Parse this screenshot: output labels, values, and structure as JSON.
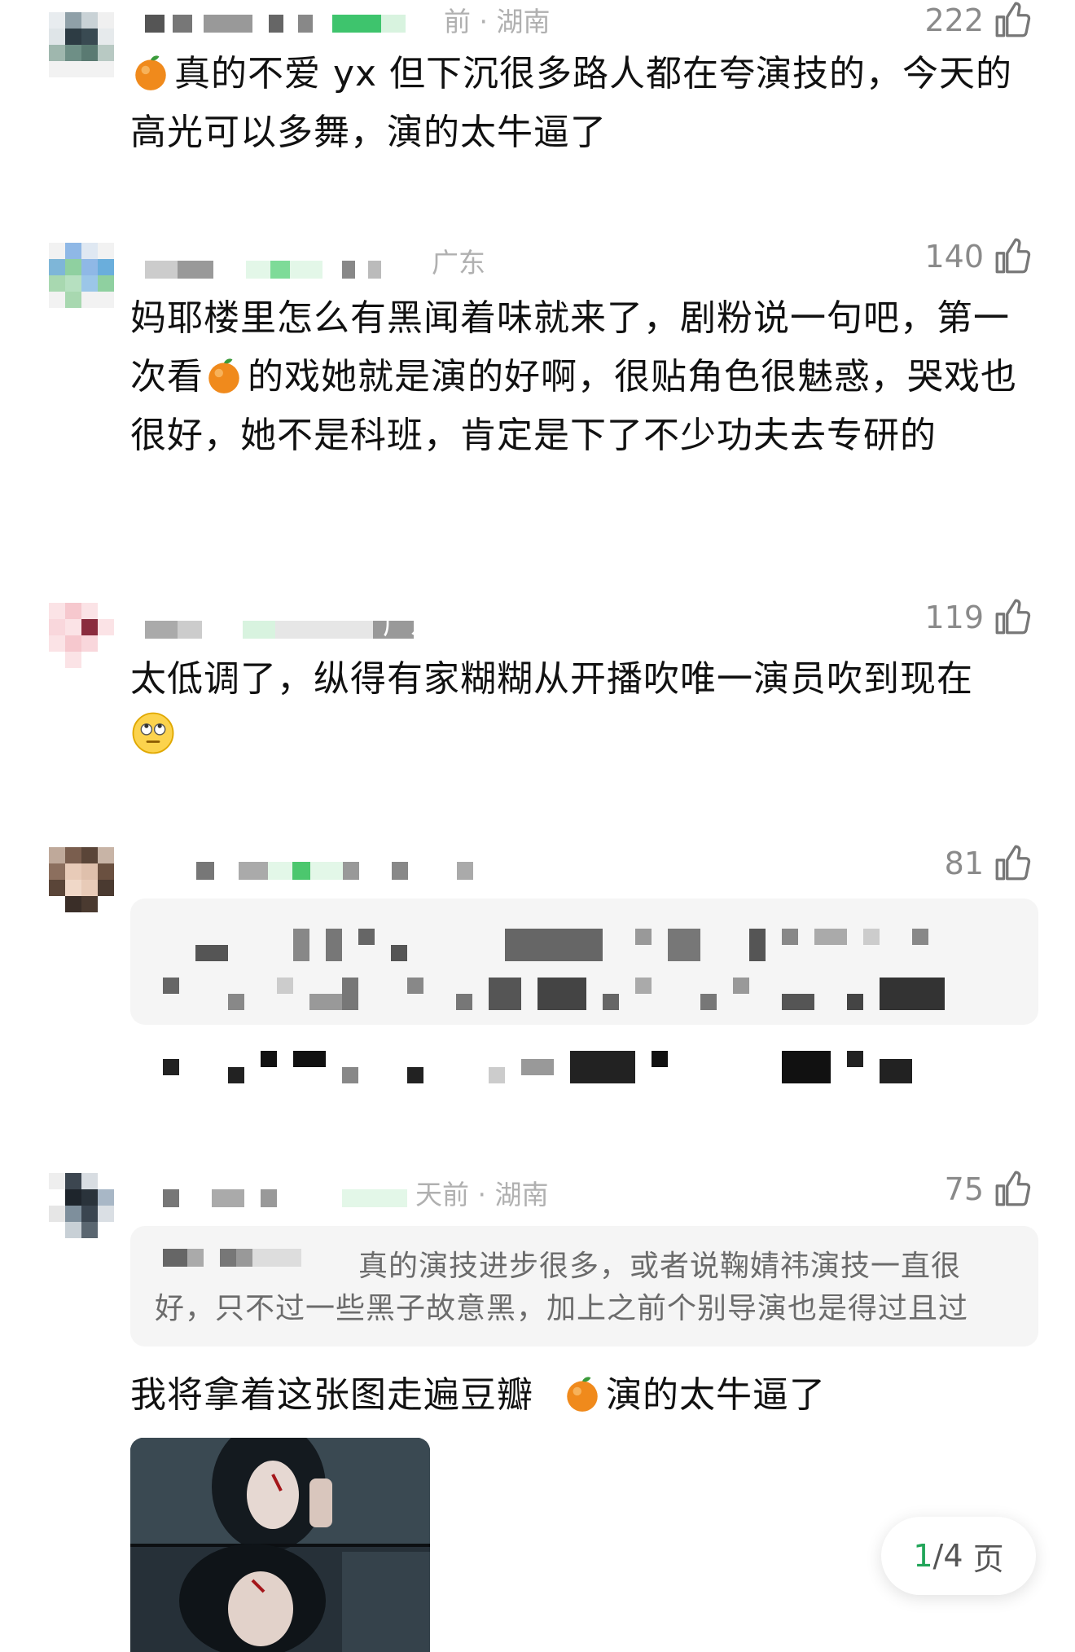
{
  "comments": [
    {
      "meta": "前 · 湖南",
      "likes": "222",
      "text_segments": [
        "真的不爱 yx 但下沉很多路人都在夸演技的，今天的高光可以多舞，演的太牛逼了"
      ]
    },
    {
      "meta": "广东",
      "likes": "140",
      "text_a": "妈耶楼里怎么有黑闻着味就来了，剧粉说一句吧，第一次看",
      "text_b": "的戏她就是演的好啊，很贴角色很魅惑，哭戏也很好，她不是科班，肯定是下了不少功夫去专研的"
    },
    {
      "meta": "广东",
      "likes": "119",
      "text": "太低调了，纵得有家糊糊从开播吹唯一演员吹到现在"
    },
    {
      "meta": "",
      "likes": "81",
      "text": ""
    },
    {
      "meta": "天前 · 湖南",
      "likes": "75",
      "quote": "真的演技进步很多，或者说鞠婧祎演技一直很好，只不过一些黑子故意黑，加上之前个别导演也是得过且过",
      "text_a": "我将拿着这张图走遍豆瓣",
      "text_b": "演的太牛逼了"
    }
  ],
  "pager": {
    "current": "1",
    "total": "/4",
    "unit": "页"
  },
  "colors": {
    "accent": "#21a559",
    "meta": "#b0b0b0",
    "quote_bg": "#f5f5f5"
  },
  "icons": [
    "thumbs-up-icon",
    "orange-emoji-icon",
    "eye-roll-emoji-icon"
  ]
}
